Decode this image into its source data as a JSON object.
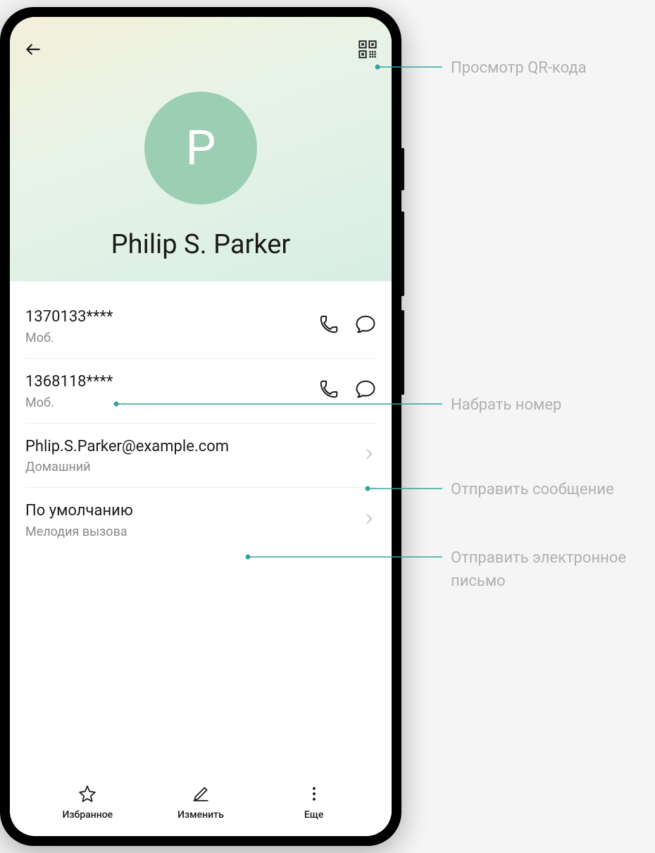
{
  "contact": {
    "initial": "P",
    "name": "Philip S. Parker"
  },
  "phones": [
    {
      "number": "1370133****",
      "type": "Моб."
    },
    {
      "number": "1368118****",
      "type": "Моб."
    }
  ],
  "email": {
    "address": "Phlip.S.Parker@example.com",
    "type": "Домашний"
  },
  "ringtone": {
    "value": "По умолчанию",
    "label": "Мелодия вызова"
  },
  "bottomBar": {
    "favorite": "Избранное",
    "edit": "Изменить",
    "more": "Еще"
  },
  "callouts": {
    "qr": "Просмотр QR-кода",
    "dial": "Набрать номер",
    "sms": "Отправить сообщение",
    "mail": "Отправить электронное письмо"
  }
}
